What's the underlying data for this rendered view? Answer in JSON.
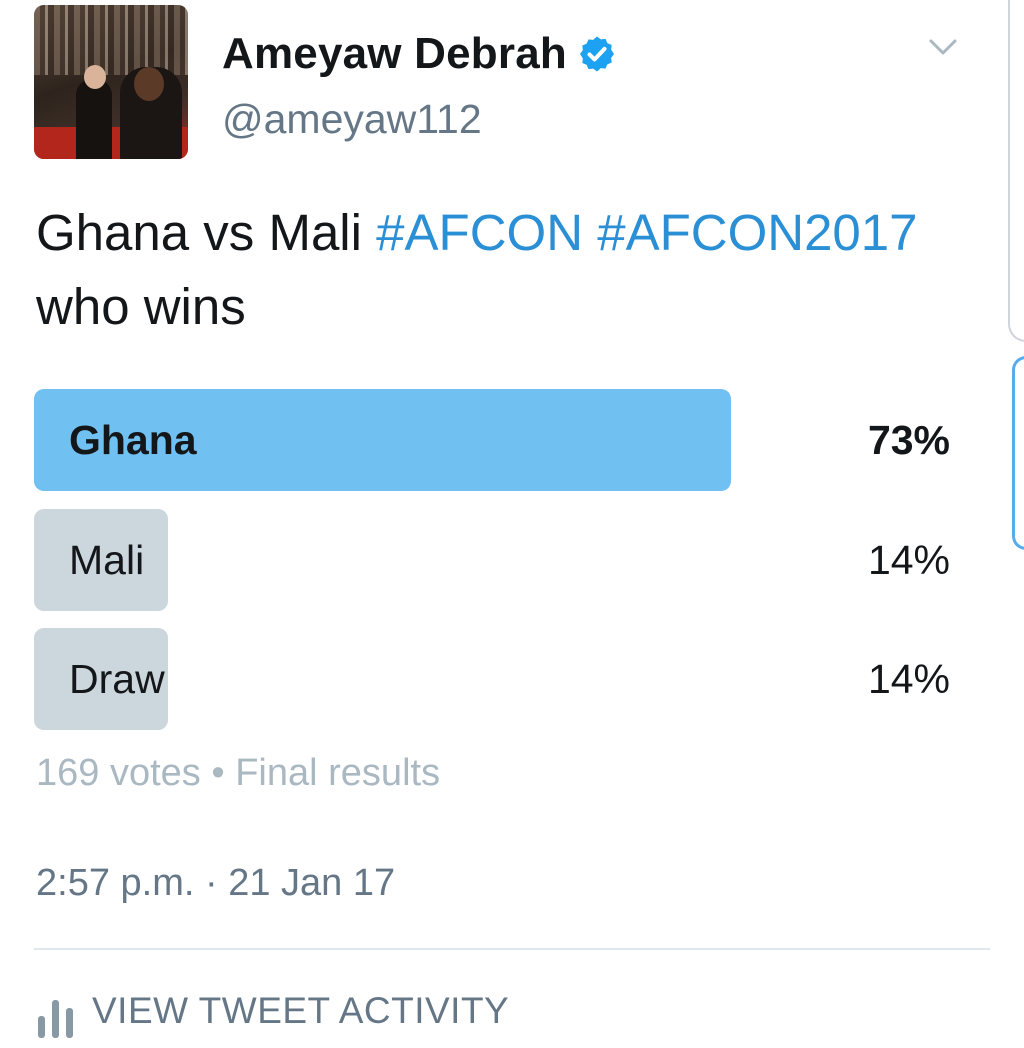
{
  "tweet": {
    "author": {
      "display_name": "Ameyaw Debrah",
      "handle": "@ameyaw112",
      "verified": true,
      "avatar_icon": "profile-photo"
    },
    "text": {
      "part1": "Ghana vs Mali ",
      "hashtag1": "#AFCON",
      "space": " ",
      "hashtag2": "#AFCON2017",
      "part2": "who wins"
    },
    "poll": {
      "options": [
        {
          "label": "Ghana",
          "percent_text": "73%",
          "fraction": 0.73,
          "winner": true
        },
        {
          "label": "Mali",
          "percent_text": "14%",
          "fraction": 0.14,
          "winner": false
        },
        {
          "label": "Draw",
          "percent_text": "14%",
          "fraction": 0.14,
          "winner": false
        }
      ],
      "votes": "169 votes",
      "separator": " • ",
      "status": "Final results"
    },
    "timestamp": "2:57 p.m. · 21 Jan 17",
    "activity_label": "VIEW TWEET ACTIVITY"
  },
  "colors": {
    "winner_bar": "#70c1f2",
    "other_bar": "#ccd6dd",
    "hashtag": "#2b8fd6",
    "verified_badge": "#1da1f2"
  },
  "icons": [
    "verified-badge-icon",
    "chevron-down-icon",
    "analytics-bar-icon"
  ]
}
